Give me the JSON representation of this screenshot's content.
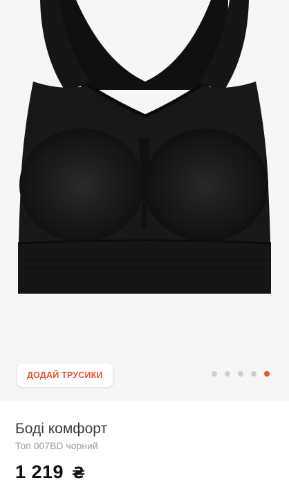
{
  "gallery": {
    "image_alt": "black seamless bra top",
    "addon_button_label": "ДОДАЙ ТРУСИКИ",
    "dots_total": 5,
    "active_dot": 5
  },
  "product": {
    "name": "Боді комфорт",
    "subtitle": "Топ 007BD чорний",
    "price": "1 219",
    "currency": "₴"
  },
  "colors": {
    "accent": "#e8532c",
    "dot_inactive": "#cfcfcf",
    "image_background": "#f6f6f6",
    "garment": "#141414"
  }
}
